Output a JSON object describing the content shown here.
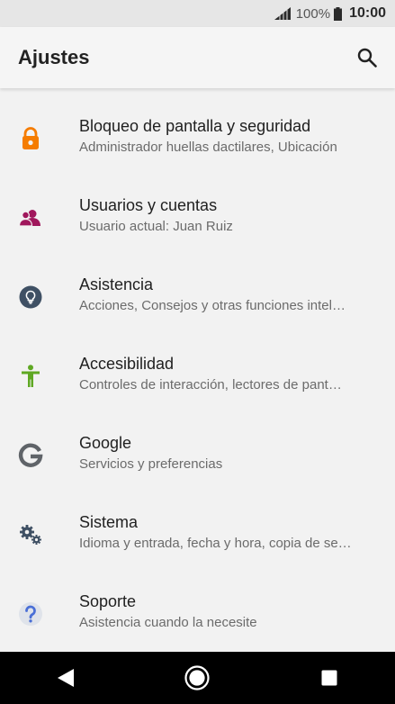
{
  "status_bar": {
    "battery_percent": "100%",
    "time": "10:00"
  },
  "header": {
    "title": "Ajustes",
    "search_icon": "search-icon"
  },
  "settings": {
    "items": [
      {
        "label": "Bloqueo de pantalla y seguridad",
        "sub": "Administrador huellas dactilares, Ubicación",
        "icon": "lock-icon",
        "color": "#f57c00"
      },
      {
        "label": "Usuarios y cuentas",
        "sub": "Usuario actual: Juan Ruiz",
        "icon": "users-icon",
        "color": "#a0175c"
      },
      {
        "label": "Asistencia",
        "sub": "Acciones, Consejos y otras funciones intel…",
        "icon": "lightbulb-icon",
        "color": "#3f5064"
      },
      {
        "label": "Accesibilidad",
        "sub": "Controles de interacción, lectores de pant…",
        "icon": "accessibility-icon",
        "color": "#5fa823"
      },
      {
        "label": "Google",
        "sub": "Servicios y preferencias",
        "icon": "google-icon",
        "color": "#5f6368"
      },
      {
        "label": "Sistema",
        "sub": "Idioma y entrada, fecha y hora, copia de se…",
        "icon": "gears-icon",
        "color": "#3f5064"
      },
      {
        "label": "Soporte",
        "sub": "Asistencia cuando la necesite",
        "icon": "help-icon",
        "color": "#4a6fd6"
      }
    ]
  },
  "nav_bar": {
    "back": "back-icon",
    "home": "home-icon",
    "recents": "recents-icon"
  }
}
